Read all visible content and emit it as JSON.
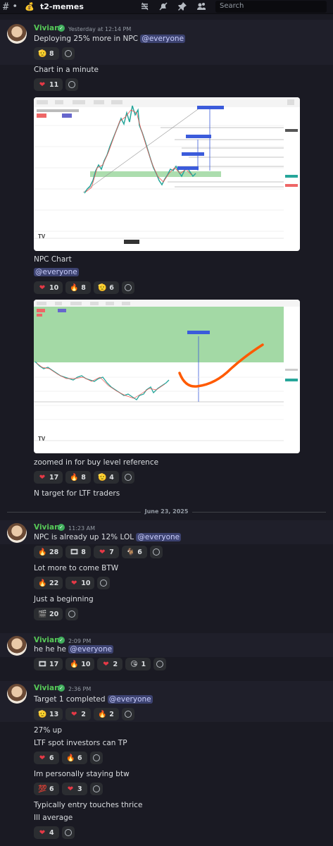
{
  "header": {
    "channel": "t2-memes",
    "search_placeholder": "Search"
  },
  "colors": {
    "bg": "#1a1a23",
    "author": "#57c957",
    "mention_bg": "#3c4270",
    "green_zone": "#a3d9a5",
    "orange_path": "#ff5a00"
  },
  "groups": [
    {
      "author": "Vivian",
      "timestamp": "Yesterday at 12:14 PM",
      "messages": [
        {
          "text": "Deploying 25% more in NPC",
          "mention": "@everyone",
          "reactions": [
            {
              "emoji": "🫡",
              "count": "8"
            }
          ]
        },
        {
          "text": "Chart in a minute",
          "reactions": [
            {
              "emoji": "❤️",
              "count": "11"
            }
          ]
        },
        {
          "text": "NPC Chart",
          "line2": "@everyone",
          "reactions": [
            {
              "emoji": "❤️",
              "count": "10"
            },
            {
              "emoji": "🔥",
              "count": "8"
            },
            {
              "emoji": "🫡",
              "count": "6"
            }
          ]
        },
        {
          "text": "zoomed in for buy level reference",
          "reactions": [
            {
              "emoji": "❤️",
              "count": "17"
            },
            {
              "emoji": "🔥",
              "count": "8"
            },
            {
              "emoji": "🫡",
              "count": "4"
            }
          ]
        },
        {
          "text": "N target for LTF traders"
        }
      ]
    },
    {
      "date_divider": "June 23, 2025",
      "author": "Vivian",
      "timestamp": "11:23 AM",
      "messages": [
        {
          "text": "NPC is already up 12% LOL",
          "mention": "@everyone",
          "reactions": [
            {
              "emoji": "🔥",
              "count": "28"
            },
            {
              "emoji": "🎞️",
              "count": "8"
            },
            {
              "emoji": "❤️",
              "count": "7"
            },
            {
              "emoji": "🐐",
              "count": "6"
            }
          ]
        },
        {
          "text": "Lot more to come BTW",
          "reactions": [
            {
              "emoji": "🔥",
              "count": "22"
            },
            {
              "emoji": "❤️",
              "count": "10"
            }
          ]
        },
        {
          "text": "Just a beginning",
          "reactions": [
            {
              "emoji": "🎬",
              "count": "20"
            }
          ]
        }
      ]
    },
    {
      "author": "Vivian",
      "timestamp": "2:09 PM",
      "messages": [
        {
          "text": "he he he",
          "mention": "@everyone",
          "reactions": [
            {
              "emoji": "🎞️",
              "count": "17"
            },
            {
              "emoji": "🔥",
              "count": "10"
            },
            {
              "emoji": "❤️",
              "count": "2"
            },
            {
              "emoji": "😘",
              "count": "1"
            }
          ]
        }
      ]
    },
    {
      "author": "Vivian",
      "timestamp": "2:36 PM",
      "messages": [
        {
          "text": "Target 1 completed",
          "mention": "@everyone",
          "reactions": [
            {
              "emoji": "🫡",
              "count": "13"
            },
            {
              "emoji": "❤️",
              "count": "2"
            },
            {
              "emoji": "🔥",
              "count": "2"
            }
          ]
        },
        {
          "text": "27% up"
        },
        {
          "text": "LTF spot investors can TP",
          "reactions": [
            {
              "emoji": "❤️",
              "count": "6"
            },
            {
              "emoji": "🔥",
              "count": "6"
            }
          ]
        },
        {
          "text": "Im personally staying btw",
          "reactions": [
            {
              "emoji": "💯",
              "count": "6"
            },
            {
              "emoji": "❤️",
              "count": "3"
            }
          ]
        },
        {
          "text": "Typically entry touches thrice"
        },
        {
          "text": "Ill average",
          "reactions": [
            {
              "emoji": "❤️",
              "count": "4"
            }
          ]
        }
      ]
    }
  ]
}
